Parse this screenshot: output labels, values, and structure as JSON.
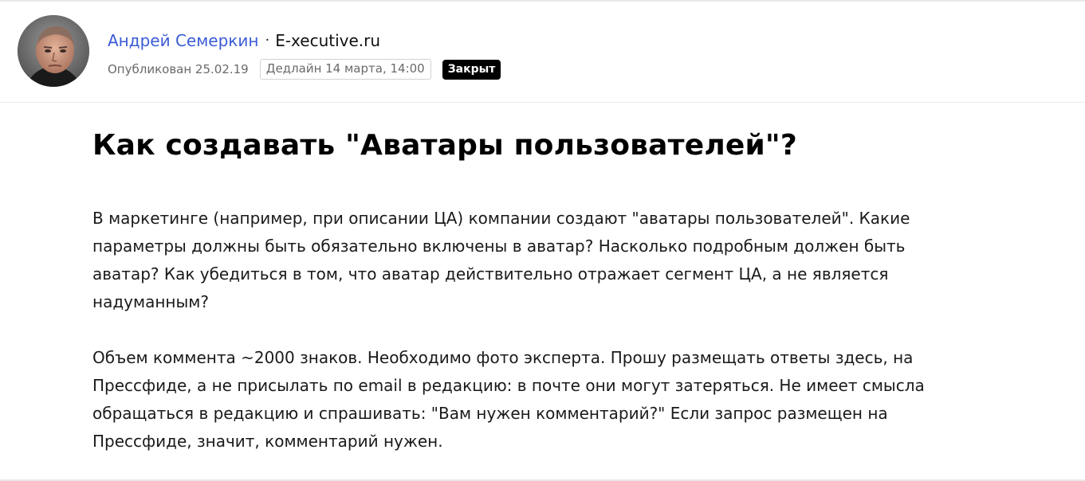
{
  "header": {
    "author_name": "Андрей Семеркин",
    "separator": "·",
    "outlet": "E-xecutive.ru",
    "published": "Опубликован 25.02.19",
    "deadline": "Дедлайн 14 марта, 14:00",
    "status": "Закрыт"
  },
  "article": {
    "title": "Как создавать \"Аватары пользователей\"?",
    "paragraphs": [
      "В маркетинге (например, при описании ЦА) компании создают \"аватары пользователей\". Какие параметры должны быть обязательно включены в аватар? Насколько подробным должен быть аватар? Как убедиться в том, что аватар действительно отражает сегмент ЦА, а не является надуманным?",
      "Объем коммента ~2000 знаков. Необходимо фото эксперта. Прошу размещать ответы здесь, на Прессфиде, а не присылать по email в редакцию: в почте они могут затеряться. Не имеет смысла обращаться в редакцию и спрашивать: \"Вам нужен комментарий?\" Если запрос размещен на Прессфиде, значит, комментарий нужен."
    ]
  },
  "colors": {
    "author_link": "#3b5bd6",
    "status_bg": "#000000",
    "status_text": "#ffffff",
    "meta_text": "#6a6a6a"
  }
}
